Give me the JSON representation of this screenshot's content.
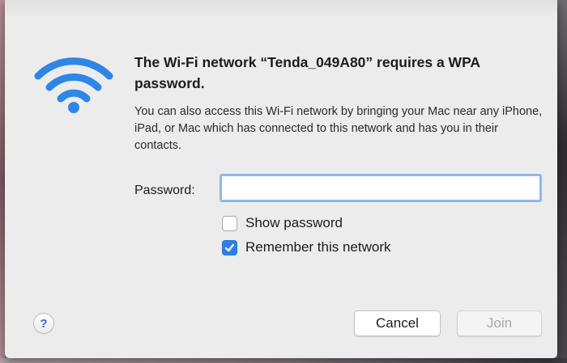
{
  "dialog": {
    "title": "The Wi-Fi network “Tenda_049A80” requires a WPA password.",
    "description": "You can also access this Wi-Fi network by bringing your Mac near any iPhone, iPad, or Mac which has connected to this network and has you in their contacts.",
    "password_label": "Password:",
    "password_value": "",
    "show_password_label": "Show password",
    "show_password_checked": false,
    "remember_label": "Remember this network",
    "remember_checked": true,
    "help_label": "?",
    "cancel_label": "Cancel",
    "join_label": "Join",
    "join_enabled": false
  },
  "icons": {
    "wifi": "wifi-icon",
    "help": "help-icon",
    "check": "checkmark-icon"
  },
  "colors": {
    "accent": "#2f7fe6",
    "wifi_blue": "#2f86e8",
    "focus_ring": "#8fb8ec"
  }
}
